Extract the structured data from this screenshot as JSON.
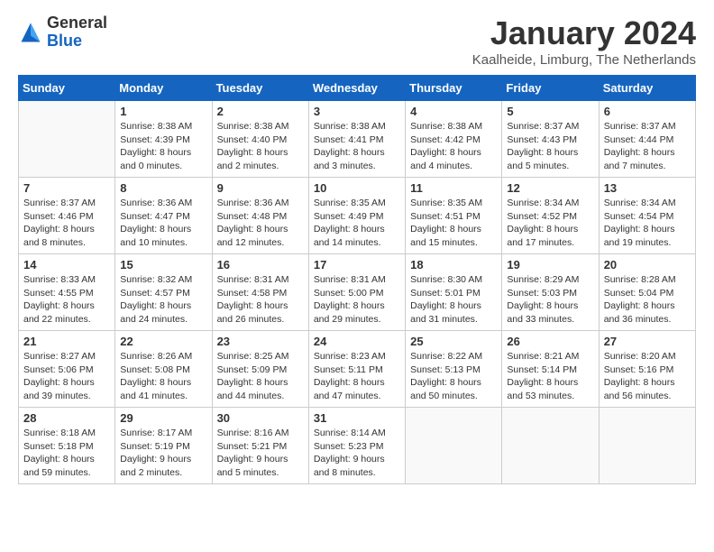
{
  "logo": {
    "text_general": "General",
    "text_blue": "Blue"
  },
  "header": {
    "month_title": "January 2024",
    "location": "Kaalheide, Limburg, The Netherlands"
  },
  "weekdays": [
    "Sunday",
    "Monday",
    "Tuesday",
    "Wednesday",
    "Thursday",
    "Friday",
    "Saturday"
  ],
  "weeks": [
    [
      {
        "day": "",
        "info": ""
      },
      {
        "day": "1",
        "info": "Sunrise: 8:38 AM\nSunset: 4:39 PM\nDaylight: 8 hours\nand 0 minutes."
      },
      {
        "day": "2",
        "info": "Sunrise: 8:38 AM\nSunset: 4:40 PM\nDaylight: 8 hours\nand 2 minutes."
      },
      {
        "day": "3",
        "info": "Sunrise: 8:38 AM\nSunset: 4:41 PM\nDaylight: 8 hours\nand 3 minutes."
      },
      {
        "day": "4",
        "info": "Sunrise: 8:38 AM\nSunset: 4:42 PM\nDaylight: 8 hours\nand 4 minutes."
      },
      {
        "day": "5",
        "info": "Sunrise: 8:37 AM\nSunset: 4:43 PM\nDaylight: 8 hours\nand 5 minutes."
      },
      {
        "day": "6",
        "info": "Sunrise: 8:37 AM\nSunset: 4:44 PM\nDaylight: 8 hours\nand 7 minutes."
      }
    ],
    [
      {
        "day": "7",
        "info": "Sunrise: 8:37 AM\nSunset: 4:46 PM\nDaylight: 8 hours\nand 8 minutes."
      },
      {
        "day": "8",
        "info": "Sunrise: 8:36 AM\nSunset: 4:47 PM\nDaylight: 8 hours\nand 10 minutes."
      },
      {
        "day": "9",
        "info": "Sunrise: 8:36 AM\nSunset: 4:48 PM\nDaylight: 8 hours\nand 12 minutes."
      },
      {
        "day": "10",
        "info": "Sunrise: 8:35 AM\nSunset: 4:49 PM\nDaylight: 8 hours\nand 14 minutes."
      },
      {
        "day": "11",
        "info": "Sunrise: 8:35 AM\nSunset: 4:51 PM\nDaylight: 8 hours\nand 15 minutes."
      },
      {
        "day": "12",
        "info": "Sunrise: 8:34 AM\nSunset: 4:52 PM\nDaylight: 8 hours\nand 17 minutes."
      },
      {
        "day": "13",
        "info": "Sunrise: 8:34 AM\nSunset: 4:54 PM\nDaylight: 8 hours\nand 19 minutes."
      }
    ],
    [
      {
        "day": "14",
        "info": "Sunrise: 8:33 AM\nSunset: 4:55 PM\nDaylight: 8 hours\nand 22 minutes."
      },
      {
        "day": "15",
        "info": "Sunrise: 8:32 AM\nSunset: 4:57 PM\nDaylight: 8 hours\nand 24 minutes."
      },
      {
        "day": "16",
        "info": "Sunrise: 8:31 AM\nSunset: 4:58 PM\nDaylight: 8 hours\nand 26 minutes."
      },
      {
        "day": "17",
        "info": "Sunrise: 8:31 AM\nSunset: 5:00 PM\nDaylight: 8 hours\nand 29 minutes."
      },
      {
        "day": "18",
        "info": "Sunrise: 8:30 AM\nSunset: 5:01 PM\nDaylight: 8 hours\nand 31 minutes."
      },
      {
        "day": "19",
        "info": "Sunrise: 8:29 AM\nSunset: 5:03 PM\nDaylight: 8 hours\nand 33 minutes."
      },
      {
        "day": "20",
        "info": "Sunrise: 8:28 AM\nSunset: 5:04 PM\nDaylight: 8 hours\nand 36 minutes."
      }
    ],
    [
      {
        "day": "21",
        "info": "Sunrise: 8:27 AM\nSunset: 5:06 PM\nDaylight: 8 hours\nand 39 minutes."
      },
      {
        "day": "22",
        "info": "Sunrise: 8:26 AM\nSunset: 5:08 PM\nDaylight: 8 hours\nand 41 minutes."
      },
      {
        "day": "23",
        "info": "Sunrise: 8:25 AM\nSunset: 5:09 PM\nDaylight: 8 hours\nand 44 minutes."
      },
      {
        "day": "24",
        "info": "Sunrise: 8:23 AM\nSunset: 5:11 PM\nDaylight: 8 hours\nand 47 minutes."
      },
      {
        "day": "25",
        "info": "Sunrise: 8:22 AM\nSunset: 5:13 PM\nDaylight: 8 hours\nand 50 minutes."
      },
      {
        "day": "26",
        "info": "Sunrise: 8:21 AM\nSunset: 5:14 PM\nDaylight: 8 hours\nand 53 minutes."
      },
      {
        "day": "27",
        "info": "Sunrise: 8:20 AM\nSunset: 5:16 PM\nDaylight: 8 hours\nand 56 minutes."
      }
    ],
    [
      {
        "day": "28",
        "info": "Sunrise: 8:18 AM\nSunset: 5:18 PM\nDaylight: 8 hours\nand 59 minutes."
      },
      {
        "day": "29",
        "info": "Sunrise: 8:17 AM\nSunset: 5:19 PM\nDaylight: 9 hours\nand 2 minutes."
      },
      {
        "day": "30",
        "info": "Sunrise: 8:16 AM\nSunset: 5:21 PM\nDaylight: 9 hours\nand 5 minutes."
      },
      {
        "day": "31",
        "info": "Sunrise: 8:14 AM\nSunset: 5:23 PM\nDaylight: 9 hours\nand 8 minutes."
      },
      {
        "day": "",
        "info": ""
      },
      {
        "day": "",
        "info": ""
      },
      {
        "day": "",
        "info": ""
      }
    ]
  ]
}
